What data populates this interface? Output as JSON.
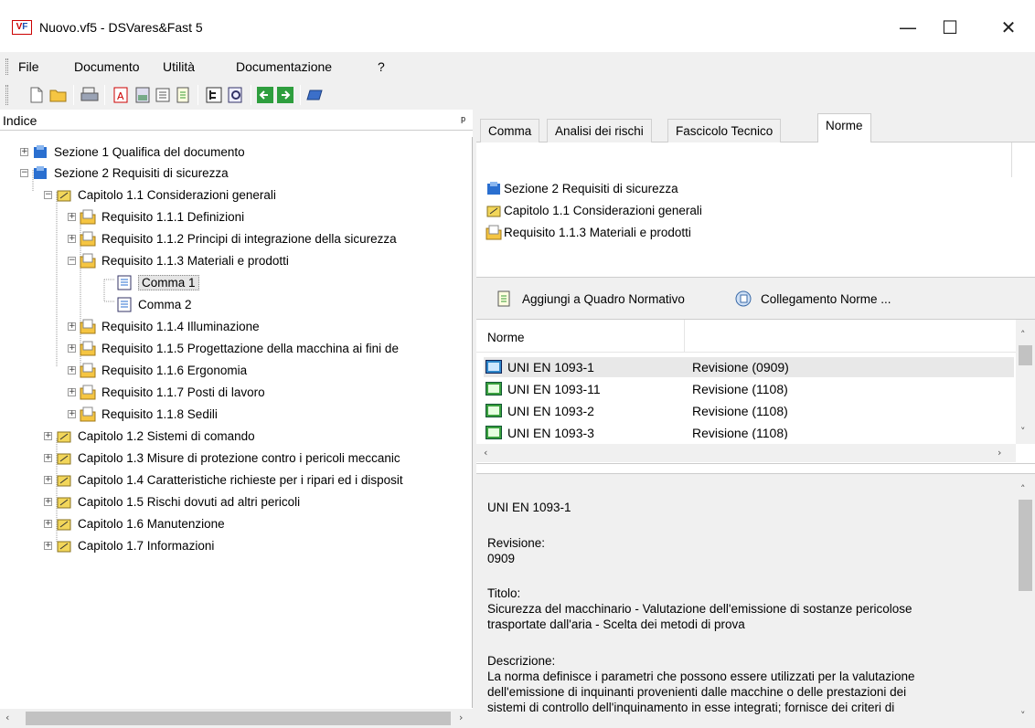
{
  "window": {
    "title": "Nuovo.vf5 - DSVares&Fast 5",
    "minimize": "—",
    "maximize": "☐",
    "close": "✕"
  },
  "menu": {
    "file": "File",
    "documento": "Documento",
    "utilita": "Utilità",
    "documentazione": "Documentazione",
    "help": "?"
  },
  "left": {
    "title": "Indice",
    "tree": [
      {
        "label": "Sezione 1 Qualifica del documento"
      },
      {
        "label": "Sezione 2 Requisiti di sicurezza"
      },
      {
        "label": "Capitolo 1.1 Considerazioni generali"
      },
      {
        "label": "Requisito 1.1.1 Definizioni"
      },
      {
        "label": "Requisito 1.1.2 Principi di integrazione della sicurezza"
      },
      {
        "label": "Requisito 1.1.3 Materiali e prodotti"
      },
      {
        "label": "Comma 1"
      },
      {
        "label": "Comma 2"
      },
      {
        "label": "Requisito 1.1.4 Illuminazione"
      },
      {
        "label": "Requisito 1.1.5 Progettazione della macchina ai fini de"
      },
      {
        "label": "Requisito 1.1.6 Ergonomia"
      },
      {
        "label": "Requisito 1.1.7 Posti di lavoro"
      },
      {
        "label": "Requisito 1.1.8 Sedili"
      },
      {
        "label": "Capitolo 1.2 Sistemi di comando"
      },
      {
        "label": "Capitolo 1.3 Misure di protezione contro i pericoli meccanic"
      },
      {
        "label": "Capitolo 1.4 Caratteristiche richieste per i ripari ed i disposit"
      },
      {
        "label": "Capitolo 1.5 Rischi dovuti ad altri pericoli"
      },
      {
        "label": "Capitolo 1.6 Manutenzione"
      },
      {
        "label": "Capitolo 1.7 Informazioni"
      }
    ]
  },
  "tabs": [
    "Comma",
    "Analisi dei rischi",
    "Fascicolo Tecnico",
    "Norme"
  ],
  "path": [
    "Sezione 2 Requisiti di sicurezza",
    "Capitolo 1.1 Considerazioni generali",
    "Requisito 1.1.3 Materiali e prodotti"
  ],
  "actions": {
    "add": "Aggiungi a Quadro Normativo",
    "link": "Collegamento Norme ..."
  },
  "norms": {
    "header": "Norme",
    "rows": [
      {
        "code": "UNI EN 1093-1",
        "rev": "Revisione (0909)"
      },
      {
        "code": "UNI EN 1093-11",
        "rev": "Revisione (1108)"
      },
      {
        "code": "UNI EN 1093-2",
        "rev": "Revisione (1108)"
      },
      {
        "code": "UNI EN 1093-3",
        "rev": "Revisione (1108)"
      }
    ]
  },
  "detail": {
    "code": "UNI EN 1093-1",
    "rev_label": "Revisione:",
    "rev_value": "0909",
    "title_label": "Titolo:",
    "title_value": "Sicurezza del macchinario - Valutazione dell'emissione di sostanze pericolose\ntrasportate dall'aria - Scelta dei metodi di prova",
    "desc_label": "Descrizione:",
    "desc_value": "La norma definisce i parametri che possono essere utilizzati per la valutazione\ndell'emissione di inquinanti provenienti dalle macchine o delle prestazioni dei\nsistemi di controllo dell'inquinamento in esse integrati; fornisce dei criteri di"
  },
  "colors": {
    "accent": "#1a4fb4",
    "brand_red": "#cc0000",
    "selection": "#e5e5e5"
  }
}
